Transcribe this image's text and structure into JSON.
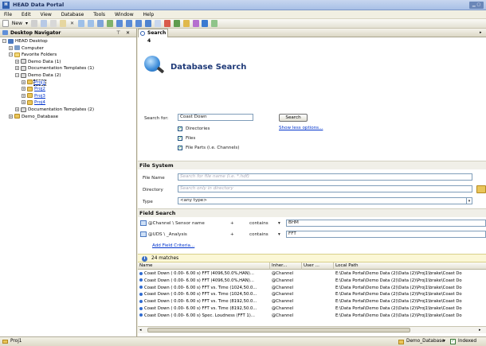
{
  "window": {
    "title": "HEAD Data Portal",
    "logo": "H"
  },
  "menu": [
    "File",
    "Edit",
    "View",
    "Database",
    "Tools",
    "Window",
    "Help"
  ],
  "toolbar": {
    "new_label": "New",
    "dropdown_glyph": "▾"
  },
  "navigator": {
    "title": "Desktop Navigator",
    "pin": "⊤",
    "close": "✕",
    "items": [
      {
        "label": "HEAD Desktop",
        "level": 0,
        "pm": "−",
        "icon": "desktop-icon"
      },
      {
        "label": "Computer",
        "level": 1,
        "pm": "+",
        "icon": "computer-icon"
      },
      {
        "label": "Favorite Folders",
        "level": 1,
        "pm": "−",
        "icon": "star-folder-icon"
      },
      {
        "label": "Demo Data (1)",
        "level": 2,
        "pm": "+",
        "icon": "template-icon"
      },
      {
        "label": "Documentation Templates (1)",
        "level": 2,
        "pm": "+",
        "icon": "template-icon"
      },
      {
        "label": "Demo Data (2)",
        "level": 2,
        "pm": "−",
        "icon": "template-icon"
      },
      {
        "label": "Proj1",
        "level": 3,
        "pm": "+",
        "icon": "folder-icon",
        "selected": true
      },
      {
        "label": "Proj2",
        "level": 3,
        "pm": "+",
        "icon": "folder-icon"
      },
      {
        "label": "Proj3",
        "level": 3,
        "pm": "+",
        "icon": "folder-icon"
      },
      {
        "label": "Proj4",
        "level": 3,
        "pm": "+",
        "icon": "folder-icon"
      },
      {
        "label": "Documentation Templates (2)",
        "level": 2,
        "pm": "+",
        "icon": "template-icon"
      },
      {
        "label": "Demo_Database",
        "level": 1,
        "pm": "+",
        "icon": "database-icon"
      }
    ]
  },
  "tab": {
    "label": "Search 4"
  },
  "search": {
    "heading": "Database Search",
    "search_for_label": "Search for:",
    "search_value": "Coast Down",
    "search_button": "Search",
    "show_less": "Show less options...",
    "checkboxes": [
      {
        "label": "Directories",
        "checked": true
      },
      {
        "label": "Files",
        "checked": true
      },
      {
        "label": "File Parts (i.e. Channels)",
        "checked": true
      }
    ],
    "check_glyph": "✓"
  },
  "filesystem": {
    "heading": "File System",
    "file_name_label": "File Name",
    "file_name_placeholder": "Search for file name (i.e. *.hdf)",
    "directory_label": "Directory",
    "directory_placeholder": "Search only in directory",
    "type_label": "Type",
    "type_value": "<any type>",
    "dd_glyph": "▾"
  },
  "fieldsearch": {
    "heading": "Field Search",
    "rows": [
      {
        "field": "@Channel \\ Sensor name",
        "plus": "+",
        "op": "contains",
        "arrow": "▾",
        "value": "BHM"
      },
      {
        "field": "@UDS \\ _Analysis",
        "plus": "+",
        "op": "contains",
        "arrow": "▾",
        "value": "FFT"
      }
    ],
    "add_label": "Add Field Criteria..."
  },
  "results": {
    "info_glyph": "i",
    "count_label": "24 matches",
    "columns": [
      "Name",
      "Inher...",
      "User ...",
      "Local Path"
    ],
    "rows": [
      {
        "name": "Coast Down ( 0.00- 6.00 s) FFT (4096,50.0%,HAN)...",
        "inher": "@Channel",
        "path": "E:\\Data Portal\\Demo Data (2)\\Data (2)\\Proj1\\brake\\Coast Do"
      },
      {
        "name": "Coast Down ( 0.00- 6.00 s) FFT (4096,50.0%,HAN)...",
        "inher": "@Channel",
        "path": "E:\\Data Portal\\Demo Data (2)\\Data (2)\\Proj1\\brake\\Coast Do"
      },
      {
        "name": "Coast Down ( 0.00- 6.00 s) FFT vs. Time (1024,50.0...",
        "inher": "@Channel",
        "path": "E:\\Data Portal\\Demo Data (2)\\Data (2)\\Proj1\\brake\\Coast Do"
      },
      {
        "name": "Coast Down ( 0.00- 6.00 s) FFT vs. Time (1024,50.0...",
        "inher": "@Channel",
        "path": "E:\\Data Portal\\Demo Data (2)\\Data (2)\\Proj1\\brake\\Coast Do"
      },
      {
        "name": "Coast Down ( 0.00- 6.00 s) FFT vs. Time (8192,50.0...",
        "inher": "@Channel",
        "path": "E:\\Data Portal\\Demo Data (2)\\Data (2)\\Proj1\\brake\\Coast Do"
      },
      {
        "name": "Coast Down ( 0.00- 6.00 s) FFT vs. Time (8192,50.0...",
        "inher": "@Channel",
        "path": "E:\\Data Portal\\Demo Data (2)\\Data (2)\\Proj1\\brake\\Coast Do"
      },
      {
        "name": "Coast Down ( 0.00- 6.00 s) Spec. Loudness (FFT 1)...",
        "inher": "@Channel",
        "path": "E:\\Data Portal\\Demo Data (2)\\Data (2)\\Proj1\\brake\\Coast Do"
      }
    ]
  },
  "status": {
    "left": "Proj1",
    "db_label": "Demo_Database",
    "indexed_label": "Indexed",
    "dd_glyph": "▾",
    "check_glyph": "✓"
  }
}
